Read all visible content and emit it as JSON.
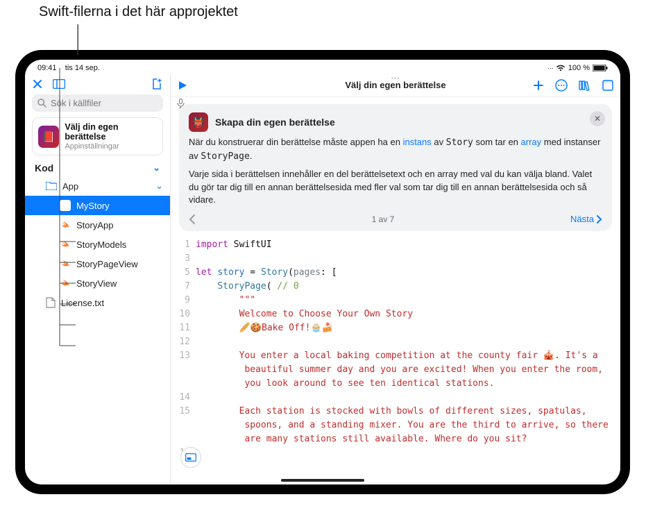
{
  "callout": {
    "label": "Swift-filerna i det här approjektet"
  },
  "status": {
    "time": "09:41",
    "date": "tis 14 sep.",
    "wifi": "wifi",
    "battery": "100 %"
  },
  "sidebar": {
    "search_placeholder": "Sök i källfiler",
    "project": {
      "title": "Välj din egen berättelse",
      "subtitle": "Appinställningar"
    },
    "section_label": "Kod",
    "folder_label": "App",
    "files": [
      {
        "name": "MyStory",
        "kind": "swift",
        "selected": true
      },
      {
        "name": "StoryApp",
        "kind": "swift",
        "selected": false
      },
      {
        "name": "StoryModels",
        "kind": "swift",
        "selected": false
      },
      {
        "name": "StoryPageView",
        "kind": "swift",
        "selected": false
      },
      {
        "name": "StoryView",
        "kind": "swift",
        "selected": false
      }
    ],
    "extra_file": "License.txt"
  },
  "main": {
    "title": "Välj din egen berättelse",
    "lesson": {
      "title": "Skapa din egen berättelse",
      "p1a": "När du konstruerar din berättelse måste appen ha en ",
      "p1_link1": "instans",
      "p1b": " av ",
      "p1_code1": "Story",
      "p1c": " som tar en ",
      "p1_link2": "array",
      "p1d": " med instanser av ",
      "p1_code2": "StoryPage",
      "p1e": ".",
      "p2": "Varje sida i berättelsen innehåller en del berättelsetext och en array med val du kan välja bland. Valet du gör tar dig till en annan berättelsesida med fler val som tar dig till en annan berättelsesida och så vidare.",
      "pager_center": "1 av 7",
      "next": "Nästa"
    }
  },
  "code": {
    "gutter": [
      "1",
      "3",
      "5",
      "7",
      "9",
      "10",
      "11",
      "12",
      "13",
      "",
      "",
      "14",
      "15",
      "",
      "",
      "16"
    ],
    "l1_kw": "import",
    "l1_mod": "SwiftUI",
    "l5_kw": "let",
    "l5_name": "story",
    "l5_eq": " = ",
    "l5_type": "Story",
    "l5_open": "(",
    "l5_arg": "pages",
    "l5_rest": ": [",
    "l7_type": "StoryPage",
    "l7_open": "( ",
    "l7_comment": "// 0",
    "l9": "\"\"\"",
    "l10": "Welcome to Choose Your Own Story",
    "l11": "🥖🍪Bake Off!🧁🍰",
    "l13a": "You enter a local baking competition at the county fair 🎪. It's a",
    "l13b": " beautiful summer day and you are excited! When you enter the room,",
    "l13c": " you look around to see ten identical stations.",
    "l15a": "Each station is stocked with bowls of different sizes, spatulas,",
    "l15b": " spoons, and a standing mixer. You are the third to arrive, so there",
    "l15c": " are many stations still available. Where do you sit?"
  },
  "chart_data": null
}
